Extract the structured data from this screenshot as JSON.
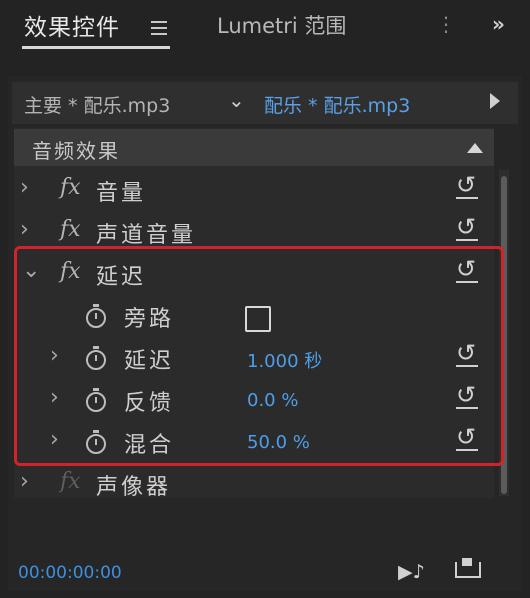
{
  "tabs": {
    "active": "效果控件",
    "second": "Lumetri 范围",
    "more": "»"
  },
  "clip_bar": {
    "master": "主要 * 配乐.mp3",
    "separator": "⌄",
    "sequence_clip": "配乐 * 配乐.mp3"
  },
  "section": {
    "title": "音频效果"
  },
  "effects": [
    {
      "label": "音量"
    },
    {
      "label": "声道音量"
    },
    {
      "label": "延迟",
      "params": [
        {
          "label": "旁路",
          "type": "checkbox",
          "checked": false
        },
        {
          "label": "延迟",
          "value": "1.000 秒"
        },
        {
          "label": "反馈",
          "value": "0.0 %"
        },
        {
          "label": "混合",
          "value": "50.0 %"
        }
      ]
    },
    {
      "label": "声像器"
    }
  ],
  "footer": {
    "timecode": "00:00:00:00"
  },
  "colors": {
    "accent": "#4f9de8",
    "highlight_border": "#d2232a"
  }
}
